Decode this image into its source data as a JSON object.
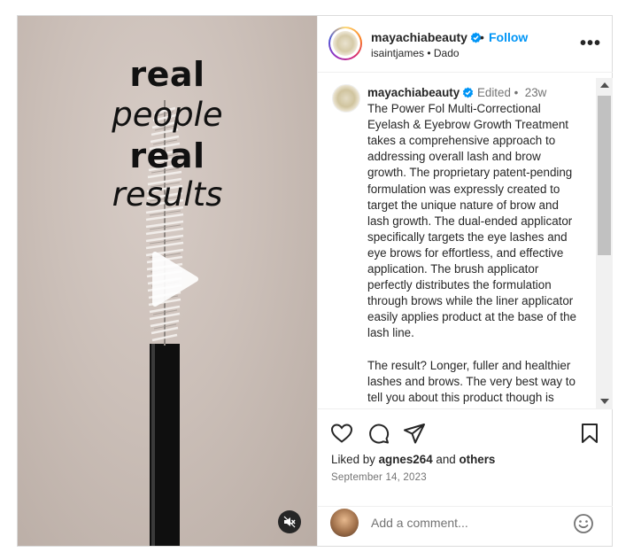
{
  "overlay": {
    "line1": "real",
    "line2": "people",
    "line3": "real",
    "line4": "results"
  },
  "header": {
    "username": "mayachiabeauty",
    "separator": "•",
    "follow_label": "Follow",
    "subtitle": "isaintjames • Dado",
    "more_label": "•••"
  },
  "caption": {
    "username": "mayachiabeauty",
    "meta": "Edited •  23w",
    "text": "The Power Fol Multi-Correctional Eyelash & Eyebrow Growth Treatment takes a comprehensive approach to addressing overall lash and brow growth. The proprietary patent-pending formulation was expressly created to target the unique nature of brow and lash growth. The dual-ended applicator specifically targets the eye lashes and eye brows for effortless, and effective application. The brush applicator perfectly distributes the formulation through brows while the liner applicator easily applies product at the base of the lash line.\n\nThe result? Longer, fuller and healthier lashes and brows. The very best way to tell you about this product though is"
  },
  "likes": {
    "prefix": "Liked by ",
    "user": "agnes264",
    "middle": " and ",
    "others": "others"
  },
  "date": "September 14, 2023",
  "comment": {
    "placeholder": "Add a comment..."
  },
  "colors": {
    "accent": "#0095f6",
    "verified": "#0095f6",
    "text": "#262626",
    "muted": "#737373"
  },
  "icons": [
    "verified-badge-icon",
    "more-icon",
    "heart-icon",
    "comment-icon",
    "share-icon",
    "bookmark-icon",
    "emoji-icon",
    "play-icon",
    "muted-audio-icon"
  ]
}
